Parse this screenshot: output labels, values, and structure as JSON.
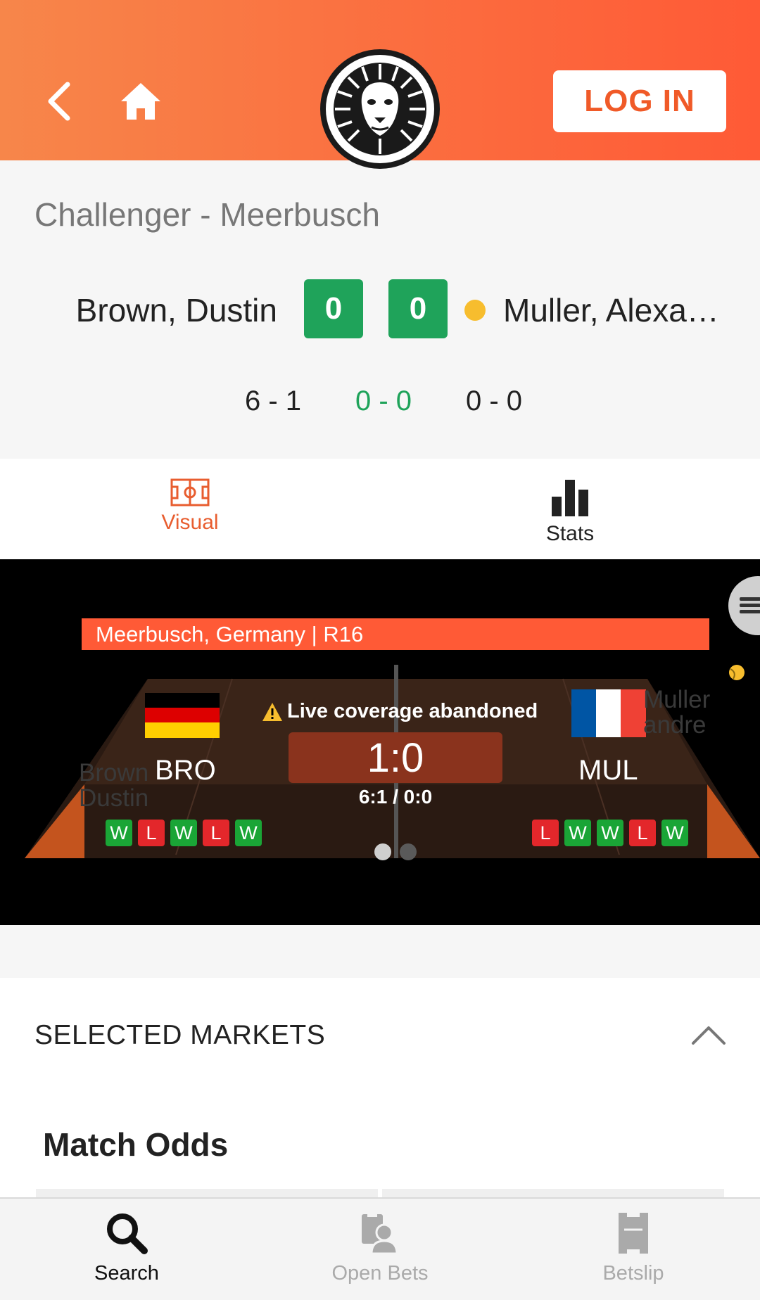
{
  "header": {
    "login_label": "LOG IN",
    "brand_color": "#ff5a36"
  },
  "match": {
    "tournament": "Challenger - Meerbusch",
    "player1": "Brown, Dustin",
    "player2": "Muller, Alexan…",
    "score_p1": "0",
    "score_p2": "0",
    "sets": [
      "6 - 1",
      "0 - 0",
      "0 - 0"
    ]
  },
  "tabs": [
    {
      "label": "Visual",
      "active": true
    },
    {
      "label": "Stats",
      "active": false
    }
  ],
  "visual": {
    "venue": "Meerbusch, Germany | R16",
    "status": "Live coverage abandoned",
    "score": "1:0",
    "set_scores": "6:1 / 0:0",
    "p1_abbr": "BRO",
    "p2_abbr": "MUL",
    "p1_name_line1": "Brown",
    "p1_name_line2": "Dustin",
    "p2_name_line1": "Muller",
    "p2_name_line2": "andre",
    "p1_form": [
      "W",
      "L",
      "W",
      "L",
      "W"
    ],
    "p2_form": [
      "L",
      "W",
      "W",
      "L",
      "W"
    ]
  },
  "markets": {
    "title": "SELECTED MARKETS",
    "market_name": "Match Odds"
  },
  "bottom_nav": [
    {
      "label": "Search",
      "icon": "search-icon",
      "active": true
    },
    {
      "label": "Open Bets",
      "icon": "open-bets-icon",
      "active": false
    },
    {
      "label": "Betslip",
      "icon": "betslip-icon",
      "active": false
    }
  ]
}
